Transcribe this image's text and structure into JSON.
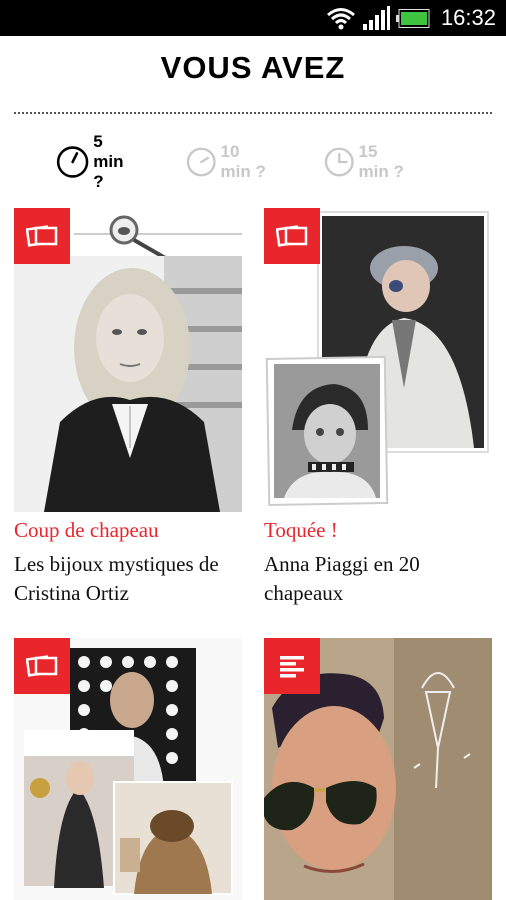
{
  "status_bar": {
    "time": "16:32",
    "icons": [
      "wifi-icon",
      "signal-icon",
      "battery-icon"
    ]
  },
  "header": {
    "title": "VOUS AVEZ"
  },
  "time_filter": {
    "options": [
      {
        "label": "5 min ?",
        "selected": true
      },
      {
        "label": "10 min ?",
        "selected": false
      },
      {
        "label": "15 min ?",
        "selected": false
      }
    ]
  },
  "articles": [
    {
      "type_icon": "gallery-icon",
      "category": "Coup de chapeau",
      "title": "Les bijoux mystiques de Cristina Ortiz"
    },
    {
      "type_icon": "gallery-icon",
      "category": "Toquée !",
      "title": "Anna Piaggi en 20 chapeaux"
    },
    {
      "type_icon": "gallery-icon"
    },
    {
      "type_icon": "article-icon"
    }
  ],
  "colors": {
    "accent": "#e8262b",
    "status_bar": "#000000",
    "inactive": "#c8c8c8"
  }
}
